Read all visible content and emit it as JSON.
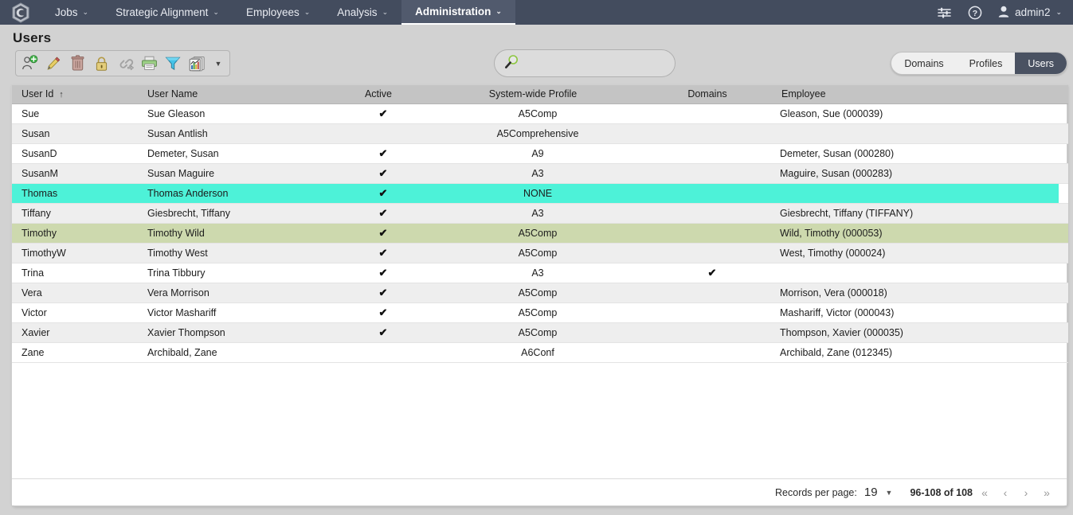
{
  "nav": {
    "logo_icon": "hexagon-logo-icon",
    "items": [
      {
        "label": "Jobs",
        "caret": "⌄",
        "active": false
      },
      {
        "label": "Strategic Alignment",
        "caret": "⌄",
        "active": false
      },
      {
        "label": "Employees",
        "caret": "⌄",
        "active": false
      },
      {
        "label": "Analysis",
        "caret": "⌄",
        "active": false
      },
      {
        "label": "Administration",
        "caret": "⌄",
        "active": true
      }
    ],
    "settings_icon": "sliders-icon",
    "help_icon": "help-circle-icon",
    "user_icon": "user-avatar-icon",
    "user_label": "admin2",
    "user_caret": "⌄"
  },
  "page": {
    "title": "Users"
  },
  "toolbar": {
    "buttons": [
      {
        "name": "add-user-icon",
        "title": "Add user"
      },
      {
        "name": "edit-pencil-icon",
        "title": "Edit"
      },
      {
        "name": "delete-trash-icon",
        "title": "Delete"
      },
      {
        "name": "lock-icon",
        "title": "Lock"
      },
      {
        "name": "link-chain-icon",
        "title": "Link"
      },
      {
        "name": "print-icon",
        "title": "Print"
      },
      {
        "name": "filter-funnel-icon",
        "title": "Filter"
      },
      {
        "name": "reports-icon",
        "title": "Reports"
      }
    ],
    "overflow_caret": "▼"
  },
  "search": {
    "icon": "magnifier-icon",
    "value": "",
    "placeholder": ""
  },
  "tabs": [
    {
      "label": "Domains",
      "active": false
    },
    {
      "label": "Profiles",
      "active": false
    },
    {
      "label": "Users",
      "active": true
    }
  ],
  "grid": {
    "columns": [
      {
        "key": "user_id",
        "label": "User Id",
        "sort": "asc",
        "sort_glyph": "↑"
      },
      {
        "key": "user_name",
        "label": "User Name"
      },
      {
        "key": "active",
        "label": "Active"
      },
      {
        "key": "profile",
        "label": "System-wide Profile"
      },
      {
        "key": "domains",
        "label": "Domains"
      },
      {
        "key": "employee",
        "label": "Employee"
      }
    ],
    "check_glyph": "✔",
    "rows": [
      {
        "user_id": "Sue",
        "user_name": "Sue Gleason",
        "active": true,
        "profile": "A5Comp",
        "domains": false,
        "employee": "Gleason, Sue (000039)",
        "style": ""
      },
      {
        "user_id": "Susan",
        "user_name": "Susan Antlish",
        "active": false,
        "profile": "A5Comprehensive",
        "domains": false,
        "employee": "",
        "style": "alt"
      },
      {
        "user_id": "SusanD",
        "user_name": "Demeter, Susan",
        "active": true,
        "profile": "A9",
        "domains": false,
        "employee": "Demeter, Susan (000280)",
        "style": ""
      },
      {
        "user_id": "SusanM",
        "user_name": "Susan Maguire",
        "active": true,
        "profile": "A3",
        "domains": false,
        "employee": "Maguire, Susan (000283)",
        "style": "alt"
      },
      {
        "user_id": "Thomas",
        "user_name": "Thomas Anderson",
        "active": true,
        "profile": "NONE",
        "domains": false,
        "employee": "",
        "style": "sel-cyan"
      },
      {
        "user_id": "Tiffany",
        "user_name": "Giesbrecht, Tiffany",
        "active": true,
        "profile": "A3",
        "domains": false,
        "employee": "Giesbrecht, Tiffany (TIFFANY)",
        "style": "alt"
      },
      {
        "user_id": "Timothy",
        "user_name": "Timothy Wild",
        "active": true,
        "profile": "A5Comp",
        "domains": false,
        "employee": "Wild, Timothy (000053)",
        "style": "sel-green"
      },
      {
        "user_id": "TimothyW",
        "user_name": "Timothy West",
        "active": true,
        "profile": "A5Comp",
        "domains": false,
        "employee": "West, Timothy (000024)",
        "style": "alt"
      },
      {
        "user_id": "Trina",
        "user_name": "Trina Tibbury",
        "active": true,
        "profile": "A3",
        "domains": true,
        "employee": "",
        "style": ""
      },
      {
        "user_id": "Vera",
        "user_name": "Vera Morrison",
        "active": true,
        "profile": "A5Comp",
        "domains": false,
        "employee": "Morrison, Vera (000018)",
        "style": "alt"
      },
      {
        "user_id": "Victor",
        "user_name": "Victor Mashariff",
        "active": true,
        "profile": "A5Comp",
        "domains": false,
        "employee": "Mashariff, Victor (000043)",
        "style": ""
      },
      {
        "user_id": "Xavier",
        "user_name": "Xavier Thompson",
        "active": true,
        "profile": "A5Comp",
        "domains": false,
        "employee": "Thompson, Xavier (000035)",
        "style": "alt"
      },
      {
        "user_id": "Zane",
        "user_name": "Archibald, Zane",
        "active": false,
        "profile": "A6Conf",
        "domains": false,
        "employee": "Archibald, Zane (012345)",
        "style": ""
      }
    ]
  },
  "footer": {
    "records_per_page_label": "Records per page:",
    "records_per_page_value": "19",
    "records_per_page_caret": "▼",
    "range_label": "96-108 of 108",
    "pager": [
      {
        "name": "first-page-button",
        "glyph": "«"
      },
      {
        "name": "prev-page-button",
        "glyph": "‹"
      },
      {
        "name": "next-page-button",
        "glyph": "›"
      },
      {
        "name": "last-page-button",
        "glyph": "»"
      }
    ]
  },
  "colors": {
    "navbar": "#434c5e",
    "nav_active": "#515a6d",
    "page_bg": "#d2d2d2",
    "header_row": "#c4c4c4",
    "row_alt": "#eeeeee",
    "select_cyan": "#4df2d8",
    "select_green": "#cdd9ae",
    "pill_active": "#4a5262"
  }
}
